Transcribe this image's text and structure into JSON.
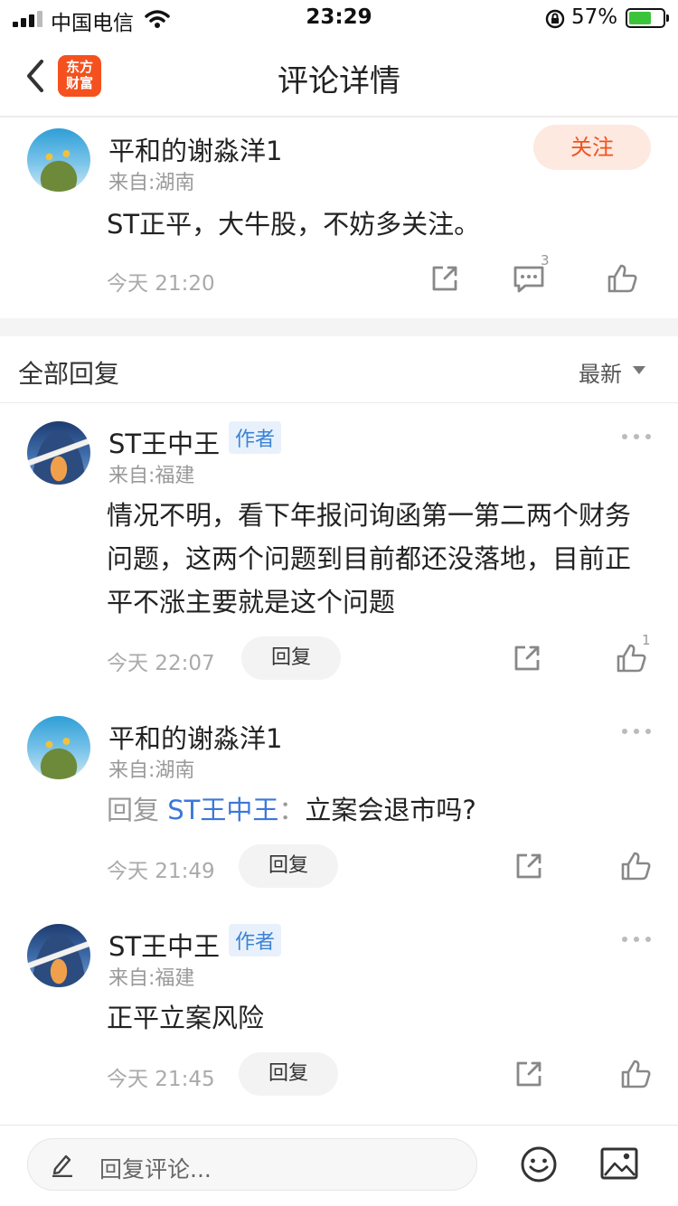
{
  "status_bar": {
    "carrier": "中国电信",
    "time": "23:29",
    "battery_pct": "57%"
  },
  "nav": {
    "logo_line1": "东方",
    "logo_line2": "财富",
    "title": "评论详情"
  },
  "post": {
    "author": "平和的谢淼洋1",
    "origin": "来自:湖南",
    "follow_label": "关注",
    "text": "ST正平，大牛股，不妨多关注。",
    "time": "今天 21:20",
    "comment_count": "3"
  },
  "replies_header": {
    "title": "全部回复",
    "sort_label": "最新"
  },
  "replies": [
    {
      "author": "ST王中王",
      "badge": "作者",
      "origin": "来自:福建",
      "text_line1": "情况不明，看下年报问询函第一第二两个财务",
      "text_line2": "问题，这两个问题到目前都还没落地，目前正",
      "text_line3": "平不涨主要就是这个问题",
      "time": "今天 22:07",
      "reply_label": "回复",
      "like_count": "1"
    },
    {
      "author": "平和的谢淼洋1",
      "origin": "来自:湖南",
      "reply_prefix": "回复",
      "reply_target": "ST王中王",
      "reply_sep": "：",
      "text": "立案会退市吗?",
      "time": "今天 21:49",
      "reply_label": "回复"
    },
    {
      "author": "ST王中王",
      "badge": "作者",
      "origin": "来自:福建",
      "text": "正平立案风险",
      "time": "今天 21:45",
      "reply_label": "回复"
    }
  ],
  "bottom_bar": {
    "placeholder": "回复评论..."
  },
  "colors": {
    "brand": "#f4511e",
    "link": "#3b78d8",
    "muted": "#999999"
  }
}
